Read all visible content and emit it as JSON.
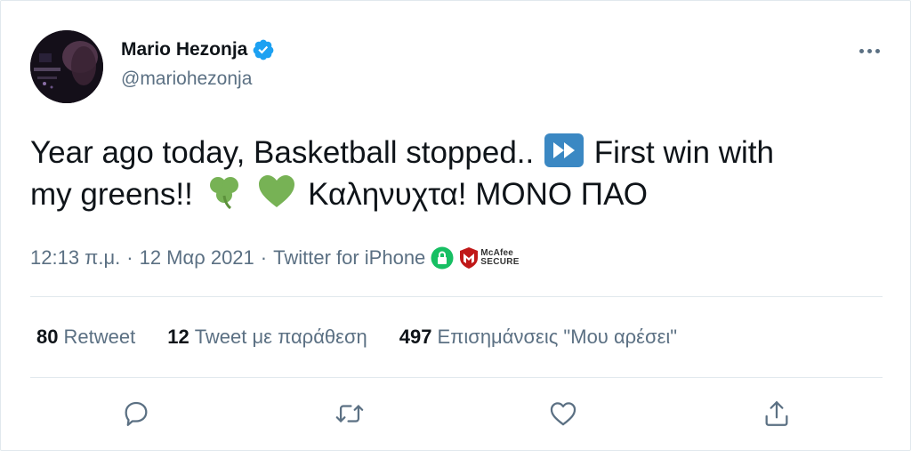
{
  "author": {
    "name": "Mario Hezonja",
    "handle": "@mariohezonja",
    "verified": true
  },
  "tweet": {
    "line1_a": "Year ago today, Basketball stopped..",
    "line1_b": "First win with",
    "line2_a": "my greens!!",
    "line2_b": "Καληνυχτα! ΜΟΝΟ ΠΑΟ",
    "emojis": [
      "fast-forward-icon",
      "shamrock-icon",
      "green-heart-icon"
    ]
  },
  "meta": {
    "time": "12:13 π.μ.",
    "separator": "·",
    "date": "12 Μαρ 2021",
    "source": "Twitter for iPhone",
    "badges": [
      "lock-icon",
      "mcafee-secure-icon"
    ],
    "mcafee_line1": "McAfee",
    "mcafee_line2": "SECURE"
  },
  "stats": [
    {
      "count": "80",
      "label": "Retweet"
    },
    {
      "count": "12",
      "label": "Tweet με παράθεση"
    },
    {
      "count": "497",
      "label": "Επισημάνσεις \"Μου αρέσει\""
    }
  ],
  "actions": [
    "reply-icon",
    "retweet-icon",
    "like-icon",
    "share-icon"
  ],
  "colors": {
    "verified": "#1da1f2",
    "secondary_text": "#5b7083",
    "primary_text": "#0f1419",
    "divider": "#e1e8ed",
    "fast_forward_bg": "#3b88c3",
    "green": "#77b255",
    "mcafee_red": "#c01818",
    "lock_green": "#17bf63"
  }
}
